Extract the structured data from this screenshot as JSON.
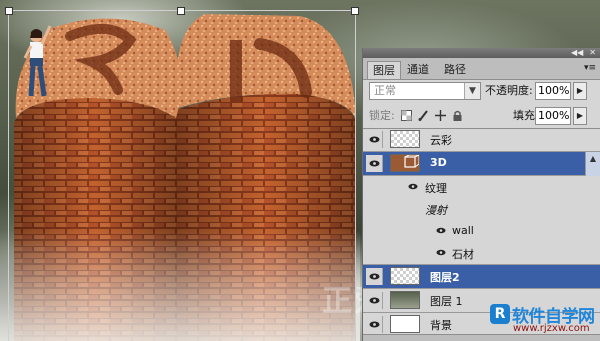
{
  "canvas": {
    "art_text": "3D"
  },
  "panel": {
    "tabs": [
      {
        "label": "图层",
        "active": true
      },
      {
        "label": "通道",
        "active": false
      },
      {
        "label": "路径",
        "active": false
      }
    ],
    "blend_mode": {
      "value": "正常"
    },
    "opacity": {
      "label": "不透明度:",
      "value": "100%"
    },
    "lock_label": "锁定:",
    "fill": {
      "label": "填充:",
      "value": "100%"
    },
    "layers": [
      {
        "name": "云彩",
        "selected": false
      },
      {
        "name": "3D",
        "selected": true,
        "sub_items": [
          "纹理",
          "漫射",
          "wall",
          "石材"
        ]
      },
      {
        "name": "图层2",
        "selected": true
      },
      {
        "name": "图层 1",
        "selected": false
      },
      {
        "name": "背景",
        "selected": false
      }
    ]
  },
  "watermark": {
    "overlay_text": "正爱好者",
    "logo_letter": "R",
    "site_name": "软件自学网",
    "site_url": "www.rjzxw.com"
  },
  "colors": {
    "selection": "#3b5fa6",
    "brick": "#b5552a",
    "panel_bg": "#d6d6d6"
  }
}
